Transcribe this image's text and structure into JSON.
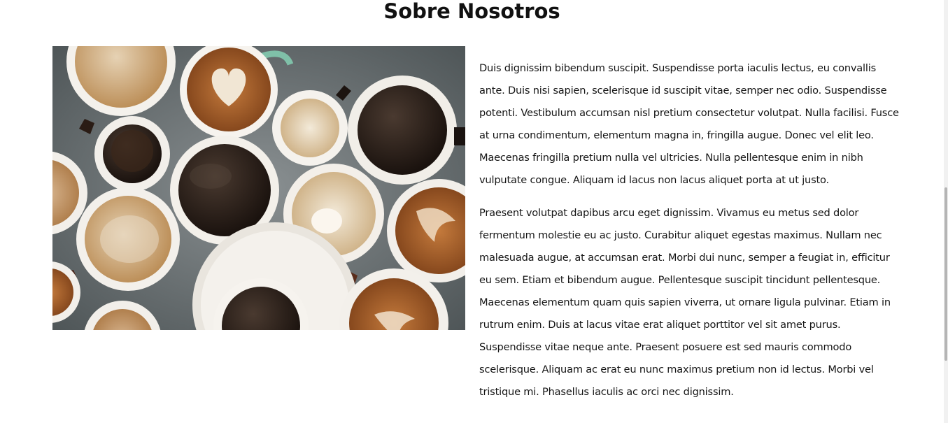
{
  "section": {
    "title": "Sobre Nosotros"
  },
  "image": {
    "alt": "Tazas de café vistas desde arriba"
  },
  "paragraphs": [
    "Duis dignissim bibendum suscipit. Suspendisse porta iaculis lectus, eu convallis ante. Duis nisi sapien, scelerisque id suscipit vitae, semper nec odio. Suspendisse potenti. Vestibulum accumsan nisl pretium consectetur volutpat. Nulla facilisi. Fusce at urna condimentum, elementum magna in, fringilla augue. Donec vel elit leo. Maecenas fringilla pretium nulla vel ultricies. Nulla pellentesque enim in nibh vulputate congue. Aliquam id lacus non lacus aliquet porta at ut justo.",
    "Praesent volutpat dapibus arcu eget dignissim. Vivamus eu metus sed dolor fermentum molestie eu ac justo. Curabitur aliquet egestas maximus. Nullam nec malesuada augue, at accumsan erat. Morbi dui nunc, semper a feugiat in, efficitur eu sem. Etiam et bibendum augue. Pellentesque suscipit tincidunt pellentesque. Maecenas elementum quam quis sapien viverra, ut ornare ligula pulvinar. Etiam in rutrum enim. Duis at lacus vitae erat aliquet porttitor vel sit amet purus. Suspendisse vitae neque ante. Praesent posuere est sed mauris commodo scelerisque. Aliquam ac erat eu nunc maximus pretium non id lectus. Morbi vel tristique mi. Phasellus iaculis ac orci nec dignissim."
  ],
  "colors": {
    "background": "#ffffff",
    "text": "#151515",
    "table_surface": "#6c7375"
  }
}
